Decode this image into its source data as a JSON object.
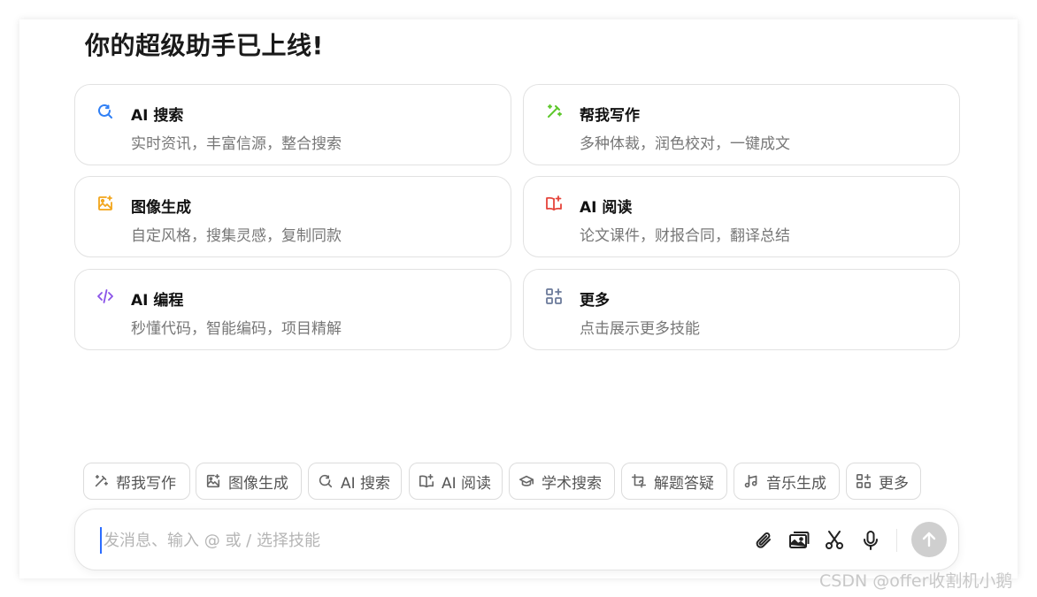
{
  "title": "你的超级助手已上线!",
  "cards": [
    {
      "title": "AI 搜索",
      "desc": "实时资讯，丰富信源，整合搜索",
      "icon": "search-refresh-icon",
      "color": "#2f7ff5"
    },
    {
      "title": "帮我写作",
      "desc": "多种体裁，润色校对，一键成文",
      "icon": "magic-pen-icon",
      "color": "#5cc72a"
    },
    {
      "title": "图像生成",
      "desc": "自定风格，搜集灵感，复制同款",
      "icon": "image-sparkle-icon",
      "color": "#f2a51b"
    },
    {
      "title": "AI 阅读",
      "desc": "论文课件，财报合同，翻译总结",
      "icon": "book-sparkle-icon",
      "color": "#e5433a"
    },
    {
      "title": "AI 编程",
      "desc": "秒懂代码，智能编码，项目精解",
      "icon": "code-icon",
      "color": "#8a52e8"
    },
    {
      "title": "更多",
      "desc": "点击展示更多技能",
      "icon": "grid-plus-icon",
      "color": "#6b7a9a"
    }
  ],
  "chips": [
    {
      "label": "帮我写作",
      "icon": "magic-pen-icon"
    },
    {
      "label": "图像生成",
      "icon": "image-sparkle-icon"
    },
    {
      "label": "AI 搜索",
      "icon": "search-refresh-icon"
    },
    {
      "label": "AI 阅读",
      "icon": "book-sparkle-icon"
    },
    {
      "label": "学术搜索",
      "icon": "graduation-cap-icon"
    },
    {
      "label": "解题答疑",
      "icon": "crop-question-icon"
    },
    {
      "label": "音乐生成",
      "icon": "music-note-icon"
    },
    {
      "label": "更多",
      "icon": "grid-plus-icon"
    }
  ],
  "input": {
    "placeholder": "发消息、输入 @ 或 / 选择技能"
  },
  "watermark": "CSDN @offer收割机小鹅"
}
